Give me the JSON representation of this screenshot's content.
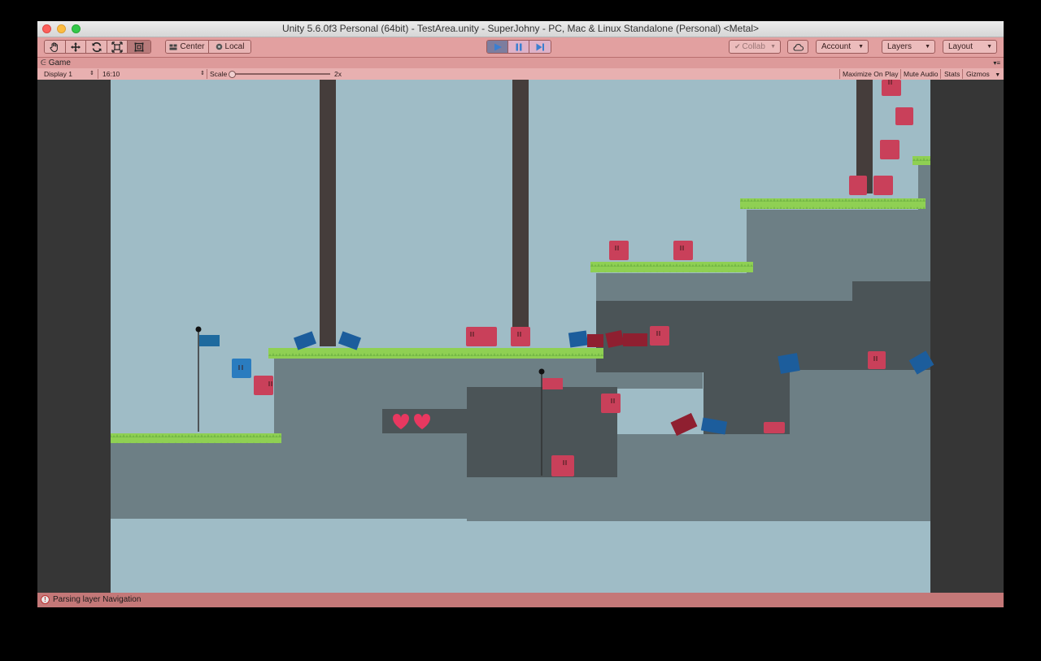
{
  "window": {
    "title": "Unity 5.6.0f3 Personal (64bit) - TestArea.unity - SuperJohny - PC, Mac & Linux Standalone (Personal) <Metal>"
  },
  "toolbar": {
    "pivot_label": "Center",
    "space_label": "Local",
    "collab_label": "Collab",
    "account_label": "Account",
    "layers_label": "Layers",
    "layout_label": "Layout"
  },
  "game_tab": {
    "title": "Game",
    "display": "Display 1",
    "aspect": "16:10",
    "scale_label": "Scale",
    "scale_value": 0.0,
    "scale_text": "2x",
    "maximize_on_play": "Maximize On Play",
    "mute_audio": "Mute Audio",
    "stats": "Stats",
    "gizmos": "Gizmos"
  },
  "status": {
    "message": "Parsing layer Navigation"
  },
  "colors": {
    "toolbar_tint": "#e2a0a0",
    "sky": "#9fbcc6",
    "ground": "#6d7f85",
    "ground_dark": "#4b5457",
    "grass": "#8fd053",
    "tree": "#453d3b",
    "red_block": "#c9405a",
    "blue_block": "#1c5d9c",
    "play_blue": "#3b7fd0"
  }
}
